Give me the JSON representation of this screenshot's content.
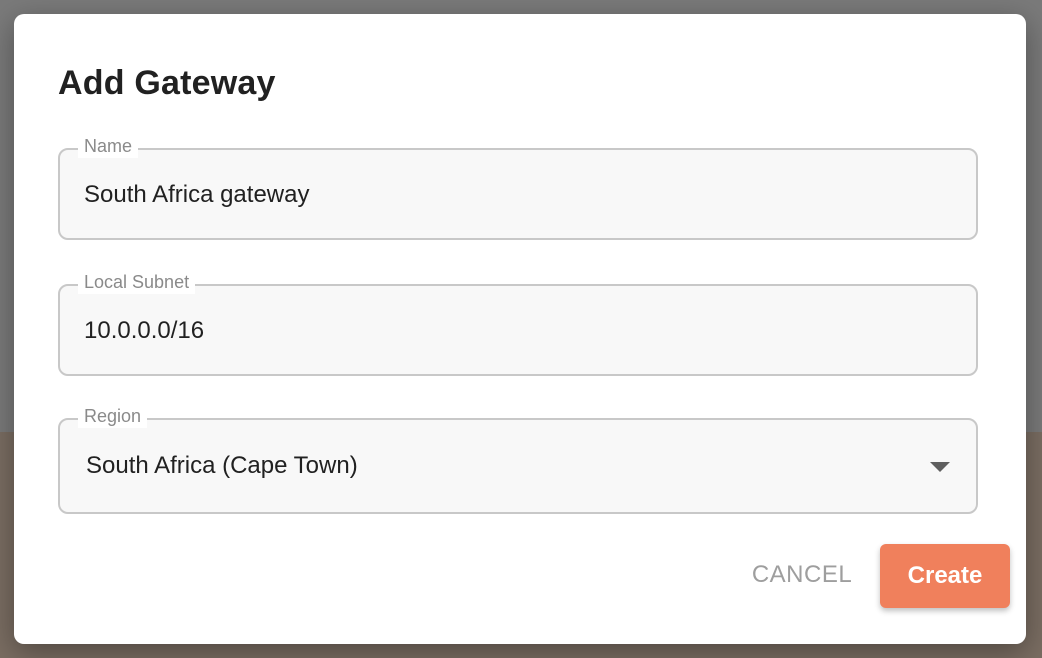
{
  "dialog": {
    "title": "Add Gateway",
    "fields": {
      "name": {
        "label": "Name",
        "value": "South Africa gateway"
      },
      "local_subnet": {
        "label": "Local Subnet",
        "value": "10.0.0.0/16"
      },
      "region": {
        "label": "Region",
        "value": "South Africa (Cape Town)",
        "icon": "dropdown-arrow-icon"
      }
    },
    "actions": {
      "cancel_label": "CANCEL",
      "create_label": "Create"
    }
  },
  "colors": {
    "accent": "#f0805c",
    "backdrop": "#7a7a7a",
    "text": "#212121",
    "muted": "#9e9e9e"
  }
}
